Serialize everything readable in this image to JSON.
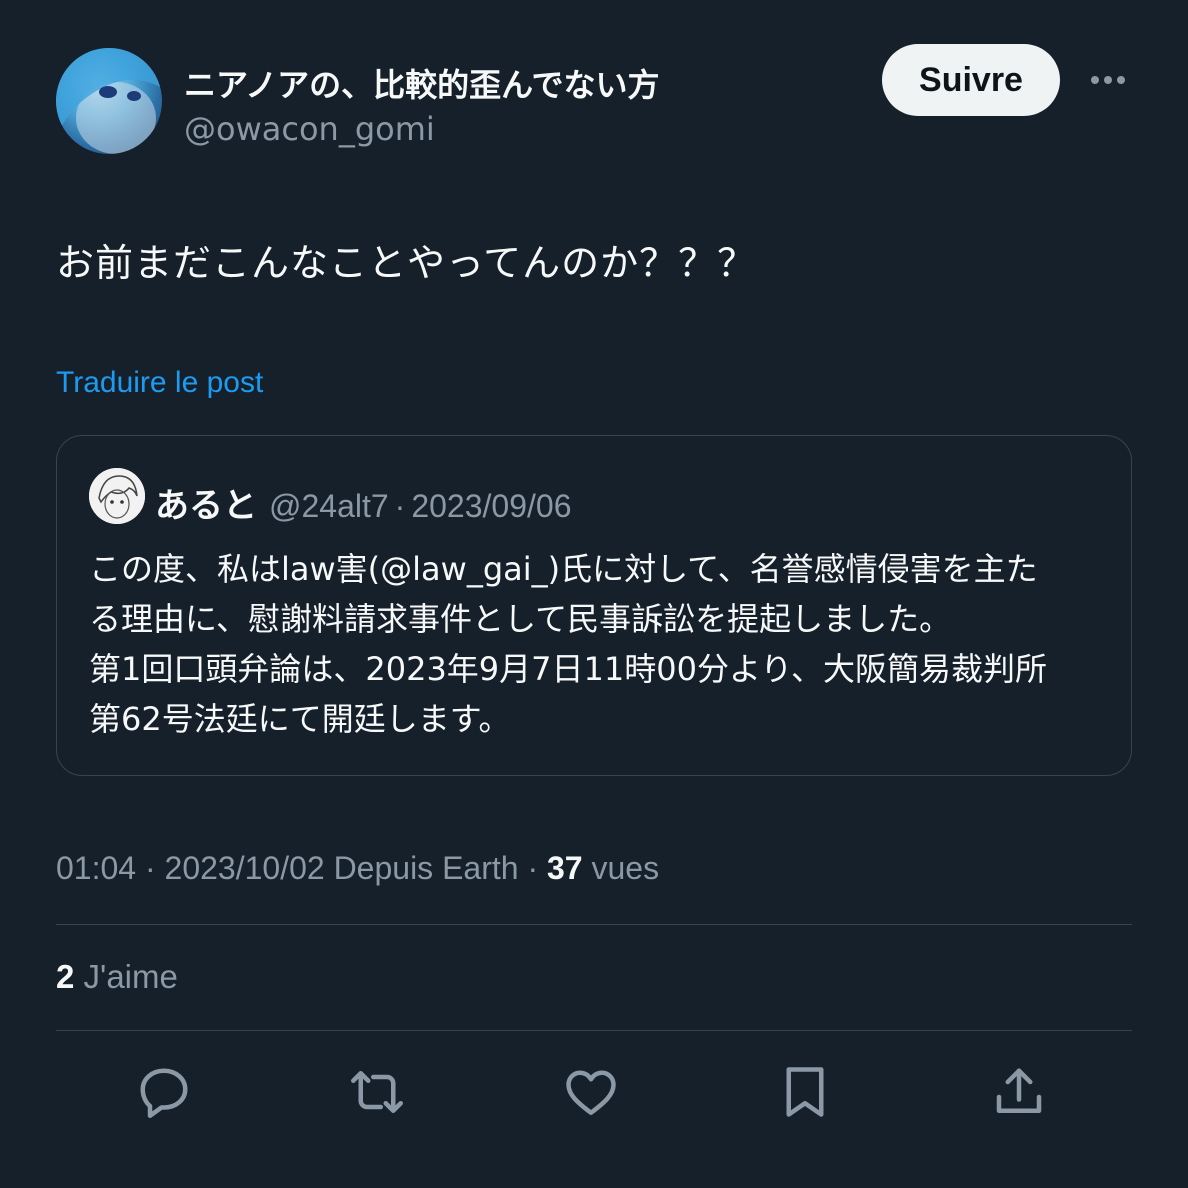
{
  "author": {
    "name": "ニアノアの、比較的歪んでない方",
    "handle": "@owacon_gomi",
    "avatar_icon": "profile-avatar"
  },
  "follow_label": "Suivre",
  "more_icon": "more-horizontal-icon",
  "post": {
    "text": "お前まだこんなことやってんのか？？？",
    "translate_label": "Traduire le post"
  },
  "quote": {
    "name": "あると",
    "handle": "@24alt7",
    "date": "2023/09/06",
    "separator": "·",
    "lines": [
      "この度、私はlaw害(@law_gai_)氏に対して、名誉感情侵害を主た",
      "る理由に、慰謝料請求事件として民事訴訟を提起しました。",
      "第1回口頭弁論は、2023年9月7日11時00分より、大阪簡易裁判所",
      "第62号法廷にて開廷します。"
    ]
  },
  "meta": {
    "time": "01:04",
    "date": "2023/10/02",
    "source": "Depuis Earth",
    "separator": "·",
    "views_count": "37",
    "views_label": "vues"
  },
  "likes": {
    "count": "2",
    "label": "J'aime"
  },
  "actions": [
    {
      "name": "reply",
      "icon": "reply-icon"
    },
    {
      "name": "repost",
      "icon": "repost-icon"
    },
    {
      "name": "like",
      "icon": "heart-icon"
    },
    {
      "name": "bookmark",
      "icon": "bookmark-icon"
    },
    {
      "name": "share",
      "icon": "share-icon"
    }
  ],
  "colors": {
    "background": "#15202b",
    "text": "#f7f9f9",
    "muted": "#8b98a5",
    "link": "#1d9bf0",
    "border": "#38444d",
    "button_bg": "#eff3f4"
  }
}
